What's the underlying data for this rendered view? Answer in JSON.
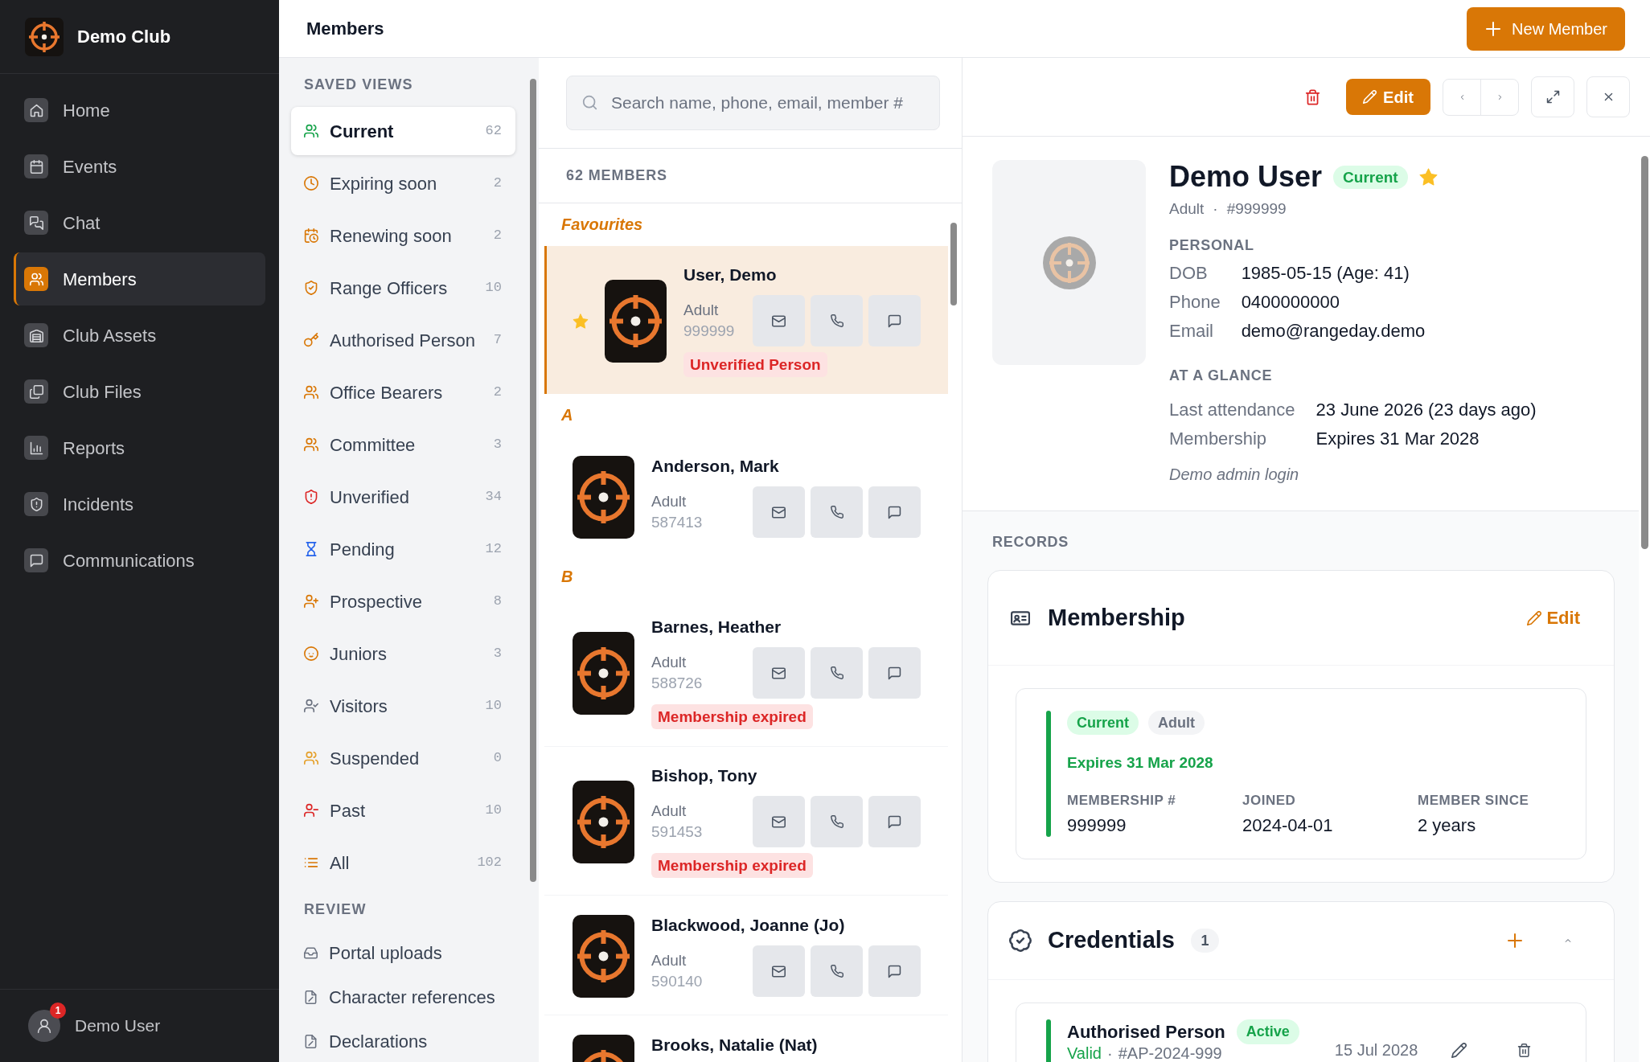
{
  "sidebar": {
    "club_name": "Demo Club",
    "items": [
      {
        "label": "Home",
        "selected": false
      },
      {
        "label": "Events",
        "selected": false
      },
      {
        "label": "Chat",
        "selected": false
      },
      {
        "label": "Members",
        "selected": true
      },
      {
        "label": "Club Assets",
        "selected": false
      },
      {
        "label": "Club Files",
        "selected": false
      },
      {
        "label": "Reports",
        "selected": false
      },
      {
        "label": "Incidents",
        "selected": false
      },
      {
        "label": "Communications",
        "selected": false
      }
    ],
    "user": {
      "name": "Demo User",
      "notification_count": "1"
    }
  },
  "header": {
    "title": "Members",
    "new_member_label": "New Member"
  },
  "saved_views": {
    "heading": "SAVED VIEWS",
    "items": [
      {
        "label": "Current",
        "count": "62",
        "selected": true
      },
      {
        "label": "Expiring soon",
        "count": "2",
        "selected": false
      },
      {
        "label": "Renewing soon",
        "count": "2",
        "selected": false
      },
      {
        "label": "Range Officers",
        "count": "10",
        "selected": false
      },
      {
        "label": "Authorised Person",
        "count": "7",
        "selected": false
      },
      {
        "label": "Office Bearers",
        "count": "2",
        "selected": false
      },
      {
        "label": "Committee",
        "count": "3",
        "selected": false
      },
      {
        "label": "Unverified",
        "count": "34",
        "selected": false
      },
      {
        "label": "Pending",
        "count": "12",
        "selected": false
      },
      {
        "label": "Prospective",
        "count": "8",
        "selected": false
      },
      {
        "label": "Juniors",
        "count": "3",
        "selected": false
      },
      {
        "label": "Visitors",
        "count": "10",
        "selected": false
      },
      {
        "label": "Suspended",
        "count": "0",
        "selected": false
      },
      {
        "label": "Past",
        "count": "10",
        "selected": false
      },
      {
        "label": "All",
        "count": "102",
        "selected": false
      }
    ],
    "review_heading": "REVIEW",
    "review_items": [
      "Portal uploads",
      "Character references",
      "Declarations"
    ]
  },
  "member_list": {
    "search": {
      "placeholder": "Search name, phone, email, member #"
    },
    "count_label": "62 MEMBERS",
    "groups": [
      {
        "label": "Favourites",
        "members": [
          {
            "name": "User, Demo",
            "category": "Adult",
            "number": "999999",
            "badge": "Unverified Person",
            "selected": true,
            "starred": true
          }
        ]
      },
      {
        "label": "A",
        "members": [
          {
            "name": "Anderson, Mark",
            "category": "Adult",
            "number": "587413",
            "selected": false,
            "starred": false
          }
        ]
      },
      {
        "label": "B",
        "members": [
          {
            "name": "Barnes, Heather",
            "category": "Adult",
            "number": "588726",
            "badge": "Membership expired",
            "selected": false,
            "starred": false
          },
          {
            "name": "Bishop, Tony",
            "category": "Adult",
            "number": "591453",
            "badge": "Membership expired",
            "selected": false,
            "starred": false
          },
          {
            "name": "Blackwood, Joanne (Jo)",
            "category": "Adult",
            "number": "590140",
            "selected": false,
            "starred": false
          },
          {
            "name": "Brooks, Natalie (Nat)",
            "selected": false,
            "starred": false
          }
        ]
      }
    ]
  },
  "detail": {
    "toolbar": {
      "edit_label": "Edit"
    },
    "profile": {
      "name": "Demo User",
      "status": "Current",
      "starred": true,
      "category": "Adult",
      "separator": "·",
      "number": "#999999",
      "sections": [
        {
          "heading": "PERSONAL",
          "rows": [
            {
              "label": "DOB",
              "value": "1985-05-15 (Age: 41)"
            },
            {
              "label": "Phone",
              "value": "0400000000"
            },
            {
              "label": "Email",
              "value": "demo@rangeday.demo"
            }
          ]
        },
        {
          "heading": "AT A GLANCE",
          "rows": [
            {
              "label": "Last attendance",
              "value": "23 June 2026 (23 days ago)"
            },
            {
              "label": "Membership",
              "value": "Expires 31 Mar 2028"
            }
          ]
        }
      ],
      "note": "Demo admin login"
    },
    "records": {
      "heading": "RECORDS",
      "membership": {
        "title": "Membership",
        "edit_label": "Edit",
        "badges": [
          {
            "text": "Current",
            "kind": "status"
          },
          {
            "text": "Adult",
            "kind": "category"
          }
        ],
        "expiry": "Expires 31 Mar 2028",
        "fields": [
          {
            "label": "MEMBERSHIP #",
            "value": "999999"
          },
          {
            "label": "JOINED",
            "value": "2024-04-01"
          },
          {
            "label": "MEMBER SINCE",
            "value": "2 years"
          }
        ]
      },
      "credentials": {
        "title": "Credentials",
        "count": "1",
        "expanded": true,
        "items": [
          {
            "title": "Authorised Person",
            "badge": "Active",
            "status": "Valid",
            "separator": "·",
            "reference": "#AP-2024-999",
            "date": "15 Jul 2028"
          }
        ]
      }
    }
  }
}
